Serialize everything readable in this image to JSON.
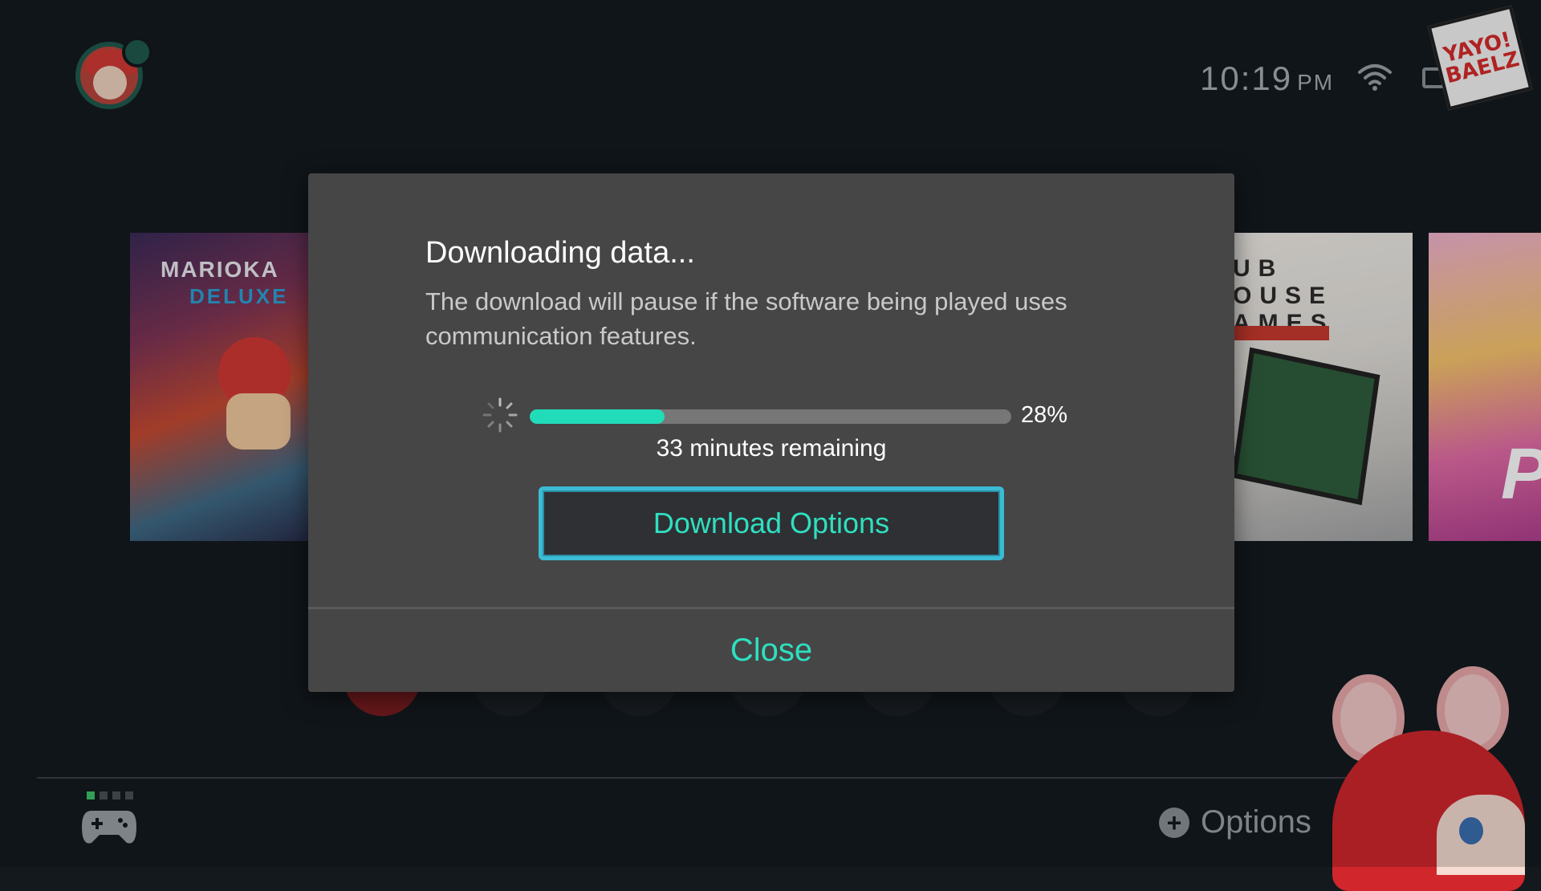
{
  "status_bar": {
    "time": "10:19",
    "ampm": "PM",
    "wifi_icon": "wifi-icon",
    "battery_icon": "battery-icon",
    "logo_text": "YAYO! BAELZ"
  },
  "user": {
    "avatar_icon": "user-avatar"
  },
  "games": [
    {
      "title_line1": "MARIOKA",
      "title_line2": "DELUXE"
    },
    {
      "title_text": "UB\nOUSE\nAMES"
    },
    {
      "title_text": "P"
    }
  ],
  "footer": {
    "options_label": "Options",
    "controller_icon": "controller-icon",
    "plus_icon": "+"
  },
  "dialog": {
    "title": "Downloading data...",
    "description": "The download will pause if the software being played uses communication features.",
    "progress_percent": 28,
    "progress_label": "28%",
    "remaining": "33 minutes remaining",
    "download_options_label": "Download Options",
    "close_label": "Close"
  },
  "colors": {
    "accent": "#2ee0c0",
    "progress_fill": "#21dcb9",
    "focus_border": "#3bbcd5",
    "dialog_bg": "#464646",
    "screen_bg": "#141a1f"
  }
}
